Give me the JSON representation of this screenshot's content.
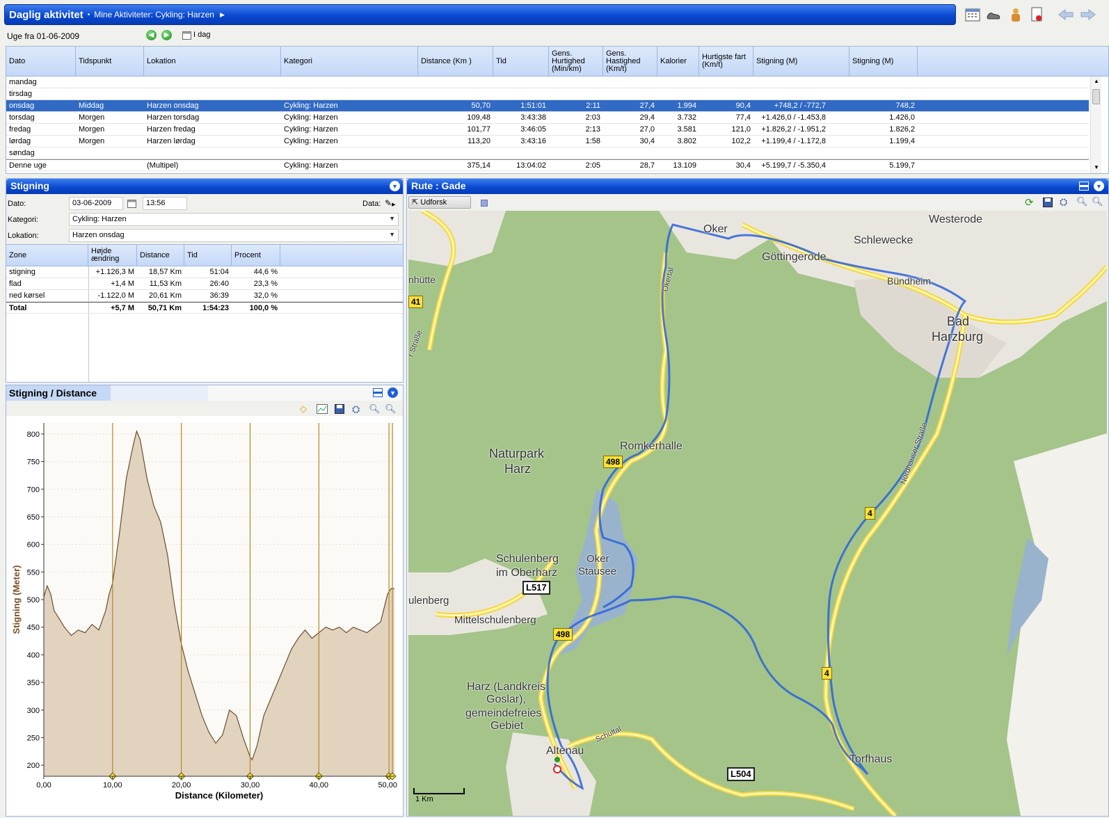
{
  "header": {
    "title": "Daglig aktivitet",
    "bullet": "•",
    "breadcrumb": "Mine Aktiviteter: Cykling: Harzen"
  },
  "week": {
    "label": "Uge fra 01-06-2009",
    "today_label": "I dag"
  },
  "activity_table": {
    "columns": [
      "Dato",
      "Tidspunkt",
      "Lokation",
      "Kategori",
      "Distance (Km )",
      "Tid",
      "Gens. Hurtighed (Min/km)",
      "Gens. Hastighed (Km/t)",
      "Kalorier",
      "Hurtigste fart (Km/t)",
      "Stigning (M)",
      "Stigning (M)"
    ],
    "rows": [
      {
        "dato": "mandag",
        "tidspunkt": "",
        "lokation": "",
        "kategori": "",
        "distance": "",
        "tid": "",
        "hurtighed": "",
        "hastighed": "",
        "kalorier": "",
        "fart": "",
        "stigning1": "",
        "stigning2": ""
      },
      {
        "dato": "tirsdag",
        "tidspunkt": "",
        "lokation": "",
        "kategori": "",
        "distance": "",
        "tid": "",
        "hurtighed": "",
        "hastighed": "",
        "kalorier": "",
        "fart": "",
        "stigning1": "",
        "stigning2": ""
      },
      {
        "dato": "onsdag",
        "tidspunkt": "Middag",
        "lokation": "Harzen onsdag",
        "kategori": "Cykling: Harzen",
        "distance": "50,70",
        "tid": "1:51:01",
        "hurtighed": "2:11",
        "hastighed": "27,4",
        "kalorier": "1.994",
        "fart": "90,4",
        "stigning1": "+748,2 / -772,7",
        "stigning2": "748,2"
      },
      {
        "dato": "torsdag",
        "tidspunkt": "Morgen",
        "lokation": "Harzen torsdag",
        "kategori": "Cykling: Harzen",
        "distance": "109,48",
        "tid": "3:43:38",
        "hurtighed": "2:03",
        "hastighed": "29,4",
        "kalorier": "3.732",
        "fart": "77,4",
        "stigning1": "+1.426,0 / -1.453,8",
        "stigning2": "1.426,0"
      },
      {
        "dato": "fredag",
        "tidspunkt": "Morgen",
        "lokation": "Harzen fredag",
        "kategori": "Cykling: Harzen",
        "distance": "101,77",
        "tid": "3:46:05",
        "hurtighed": "2:13",
        "hastighed": "27,0",
        "kalorier": "3.581",
        "fart": "121,0",
        "stigning1": "+1.826,2 / -1.951,2",
        "stigning2": "1.826,2"
      },
      {
        "dato": "lørdag",
        "tidspunkt": "Morgen",
        "lokation": "Harzen lørdag",
        "kategori": "Cykling: Harzen",
        "distance": "113,20",
        "tid": "3:43:16",
        "hurtighed": "1:58",
        "hastighed": "30,4",
        "kalorier": "3.802",
        "fart": "102,2",
        "stigning1": "+1.199,4 / -1.172,8",
        "stigning2": "1.199,4"
      },
      {
        "dato": "søndag",
        "tidspunkt": "",
        "lokation": "",
        "kategori": "",
        "distance": "",
        "tid": "",
        "hurtighed": "",
        "hastighed": "",
        "kalorier": "",
        "fart": "",
        "stigning1": "",
        "stigning2": ""
      },
      {
        "dato": "Denne uge",
        "tidspunkt": "",
        "lokation": "(Multipel)",
        "kategori": "Cykling: Harzen",
        "distance": "375,14",
        "tid": "13:04:02",
        "hurtighed": "2:05",
        "hastighed": "28,7",
        "kalorier": "13.109",
        "fart": "30,4",
        "stigning1": "+5.199,7 / -5.350,4",
        "stigning2": "5.199,7"
      }
    ]
  },
  "stigning_panel": {
    "title": "Stigning",
    "dato_label": "Dato:",
    "dato_value": "03-06-2009",
    "time_value": "13:56",
    "data_label": "Data:",
    "kategori_label": "Kategori:",
    "kategori_value": "Cykling: Harzen",
    "lokation_label": "Lokation:",
    "lokation_value": "Harzen onsdag",
    "zone_columns": [
      "Zone",
      "Højde ændring",
      "Distance",
      "Tid",
      "Procent"
    ],
    "zones": [
      {
        "zone": "stigning",
        "hojde": "+1.126,3 M",
        "distance": "18,57 Km",
        "tid": "51:04",
        "procent": "44,6 %"
      },
      {
        "zone": "flad",
        "hojde": "+1,4 M",
        "distance": "11,53 Km",
        "tid": "26:40",
        "procent": "23,3 %"
      },
      {
        "zone": "ned kørsel",
        "hojde": "-1.122,0 M",
        "distance": "20,61 Km",
        "tid": "36:39",
        "procent": "32,0 %"
      }
    ],
    "total": {
      "zone": "Total",
      "hojde": "+5,7 M",
      "distance": "50,71 Km",
      "tid": "1:54:23",
      "procent": "100,0 %"
    }
  },
  "chart_panel": {
    "title": "Stigning / Distance"
  },
  "chart_data": {
    "type": "area",
    "xlabel": "Distance (Kilometer)",
    "ylabel": "Stigning (Meter)",
    "xlim": [
      0,
      51
    ],
    "ylim": [
      180,
      820
    ],
    "xticks": [
      "0,00",
      "10,00",
      "20,00",
      "30,00",
      "40,00",
      "50,00"
    ],
    "yticks": [
      "200",
      "250",
      "300",
      "350",
      "400",
      "450",
      "500",
      "550",
      "600",
      "650",
      "700",
      "750",
      "800"
    ],
    "markers_km": [
      10,
      20,
      30,
      40,
      50.2,
      50.7
    ],
    "fill_color": "#e2d3bf",
    "line_color": "#6b4d2d",
    "x": [
      0,
      0.5,
      1,
      1.5,
      2,
      3,
      4,
      5,
      6,
      7,
      8,
      9,
      9.5,
      10,
      11,
      12,
      13,
      13.5,
      14,
      15,
      16,
      17,
      18,
      19,
      20,
      21,
      22,
      23,
      24,
      25,
      26,
      27,
      28,
      29,
      30,
      30.3,
      31,
      32,
      33,
      34,
      35,
      36,
      37,
      38,
      39,
      40,
      41,
      42,
      43,
      44,
      45,
      46,
      47,
      48,
      49,
      50,
      50.5,
      51
    ],
    "y": [
      505,
      525,
      510,
      480,
      470,
      450,
      435,
      445,
      440,
      455,
      445,
      480,
      510,
      530,
      620,
      720,
      780,
      805,
      790,
      720,
      670,
      640,
      580,
      490,
      420,
      370,
      330,
      290,
      260,
      240,
      255,
      300,
      290,
      250,
      215,
      210,
      235,
      290,
      320,
      350,
      380,
      410,
      430,
      445,
      430,
      440,
      450,
      445,
      450,
      440,
      450,
      445,
      440,
      450,
      460,
      510,
      520,
      520
    ]
  },
  "map_panel": {
    "title": "Rute : Gade",
    "explore_label": "Udforsk",
    "scale_label": "1 Km",
    "labels": {
      "westerode": "Westerode",
      "schlewecke": "Schlewecke",
      "oker": "Oker",
      "gottingerode": "Göttingerode",
      "burgbeim": "Bündheim",
      "bad": "Bad",
      "harzburg": "Harzburg",
      "hutte": "nhütte",
      "naturpark1": "Naturpark",
      "naturpark2": "Harz",
      "romkerhalle": "Romkerhalle",
      "schulenberg1": "Schulenberg",
      "schulenberg2": "im Oberharz",
      "oker_stausee1": "Oker",
      "oker_stausee2": "Stausee",
      "ulenberg": "ulenberg",
      "mittelschulenberg": "Mittelschulenberg",
      "harz1": "Harz (Landkreis",
      "harz2": "Goslar),",
      "harz3": "gemeindefreies",
      "harz4": "Gebiet",
      "altenau": "Altenau",
      "torfhaus": "Torfhaus",
      "oker_road": "Okertal",
      "nordhauser": "Nordhäuser Straße",
      "schultal": "Schultal",
      "strasse": "r Straße"
    },
    "signs": {
      "s498a": "498",
      "s498b": "498",
      "s4a": "4",
      "s4b": "4",
      "l517": "L517",
      "l504": "L504",
      "s41": "41"
    }
  }
}
